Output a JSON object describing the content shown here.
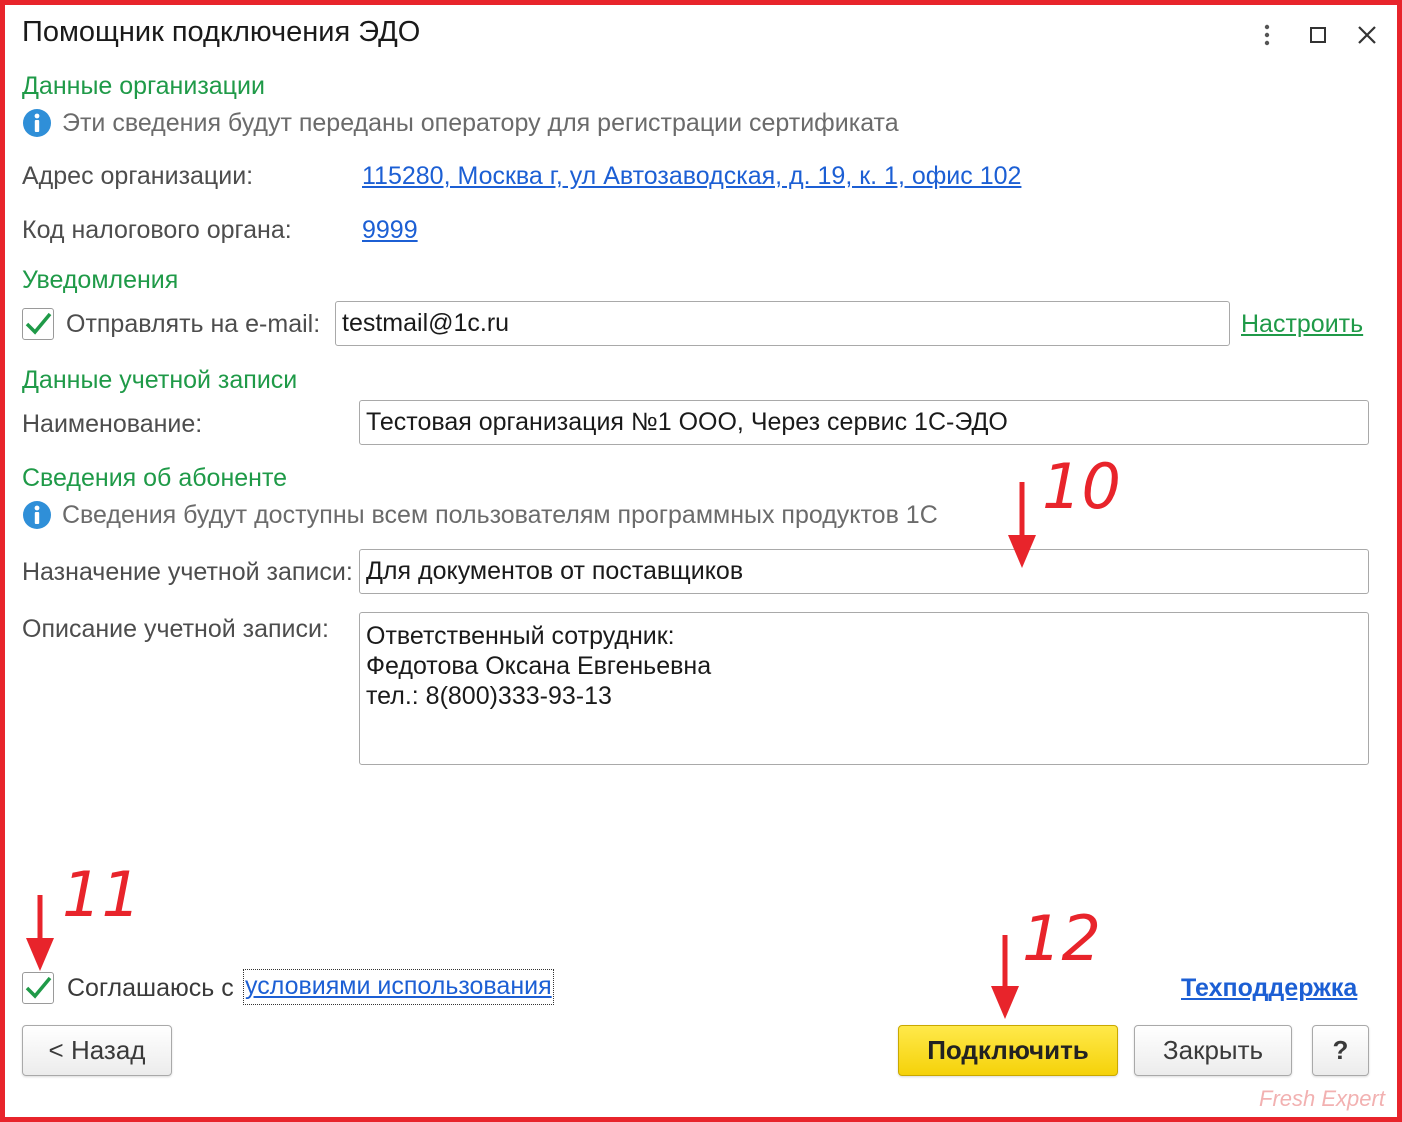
{
  "window": {
    "title": "Помощник подключения ЭДО"
  },
  "org_data": {
    "section_title": "Данные организации",
    "info_text": "Эти сведения будут переданы оператору для регистрации сертификата",
    "address_label": "Адрес организации:",
    "address_value": "115280, Москва г, ул Автозаводская, д. 19, к. 1, офис 102",
    "tax_code_label": "Код налогового органа:",
    "tax_code_value": "9999"
  },
  "notifications": {
    "section_title": "Уведомления",
    "email_checked": true,
    "email_label": "Отправлять на e-mail:",
    "email_value": "testmail@1c.ru",
    "configure_link": "Настроить"
  },
  "account": {
    "section_title": "Данные учетной записи",
    "name_label": "Наименование:",
    "name_value": "Тестовая организация №1 ООО, Через сервис 1С-ЭДО"
  },
  "subscriber": {
    "section_title": "Сведения об абоненте",
    "info_text": "Сведения будут доступны всем пользователям программных продуктов 1С",
    "purpose_label": "Назначение учетной записи:",
    "purpose_value": "Для документов от поставщиков",
    "description_label": "Описание учетной записи:",
    "description_lines": [
      "Ответственный сотрудник:",
      "Федотова Оксана Евгеньевна",
      "тел.: 8(800)333-93-13"
    ]
  },
  "agreement": {
    "checked": true,
    "text": "Соглашаюсь с",
    "link": "условиями использования"
  },
  "footer": {
    "support_link": "Техподдержка",
    "back_button": "< Назад",
    "connect_button": "Подключить",
    "close_button": "Закрыть",
    "help_button": "?"
  },
  "annotations": {
    "step10": "10",
    "step11": "11",
    "step12": "12",
    "color": "#e8242b"
  },
  "watermark": "Fresh Expert",
  "colors": {
    "frame": "#e8242b",
    "section": "#1f9a48",
    "link": "#1c5fd4",
    "primary_button": "#f5d20a",
    "info_icon": "#2f8fd8"
  }
}
